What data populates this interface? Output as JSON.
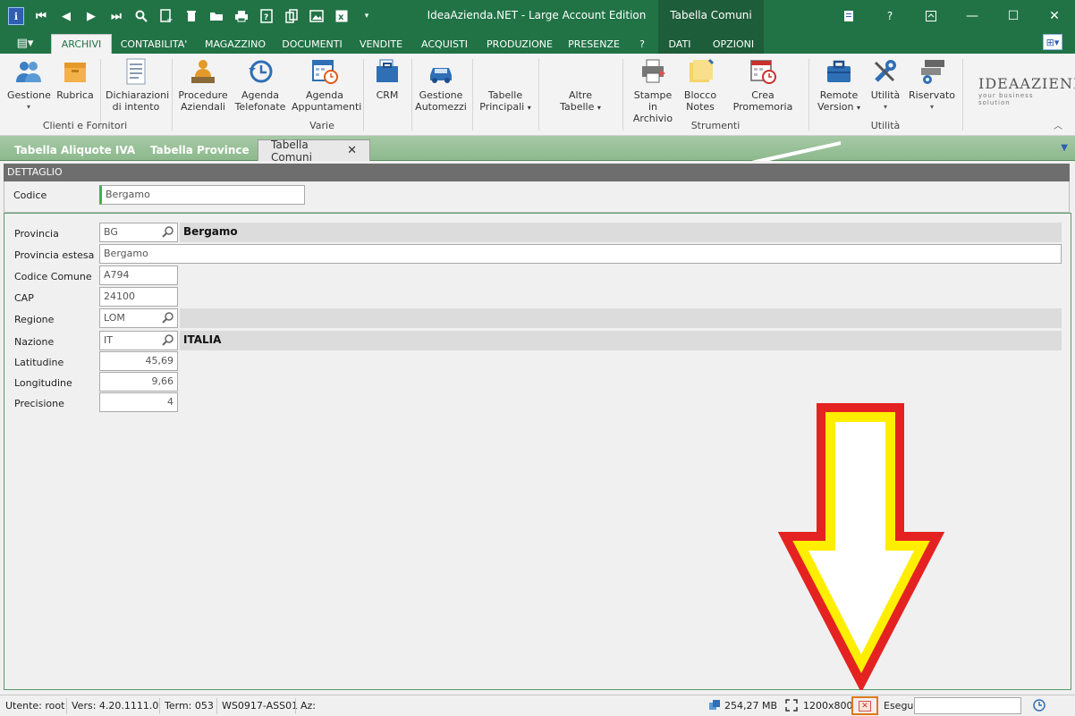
{
  "window": {
    "title": "IdeaAzienda.NET - Large Account Edition",
    "context_tab_title": "Tabella Comuni"
  },
  "ribbon_tabs": [
    {
      "label": "ARCHIVI",
      "active": true
    },
    {
      "label": "CONTABILITA'"
    },
    {
      "label": "MAGAZZINO"
    },
    {
      "label": "DOCUMENTI"
    },
    {
      "label": "VENDITE"
    },
    {
      "label": "ACQUISTI"
    },
    {
      "label": "PRODUZIONE"
    },
    {
      "label": "PRESENZE"
    },
    {
      "label": "?"
    },
    {
      "label": "DATI"
    },
    {
      "label": "OPZIONI"
    }
  ],
  "ribbon": {
    "buttons": {
      "gestione": "Gestione",
      "rubrica": "Rubrica",
      "dichiarazioni_1": "Dichiarazioni",
      "dichiarazioni_2": "di intento",
      "procedure_1": "Procedure",
      "procedure_2": "Aziendali",
      "agenda_tel_1": "Agenda",
      "agenda_tel_2": "Telefonate",
      "agenda_app_1": "Agenda",
      "agenda_app_2": "Appuntamenti",
      "crm": "CRM",
      "automezzi_1": "Gestione",
      "automezzi_2": "Automezzi",
      "tabelle_princ_1": "Tabelle",
      "tabelle_princ_2": "Principali",
      "altre_tab_1": "Altre",
      "altre_tab_2": "Tabelle",
      "stampe_1": "Stampe in",
      "stampe_2": "Archivio",
      "blocco_1": "Blocco",
      "blocco_2": "Notes",
      "promemoria": "Crea Promemoria",
      "remote_1": "Remote",
      "remote_2": "Version",
      "utilita": "Utilità",
      "riservato": "Riservato"
    },
    "groups": {
      "clienti_fornitori": "Clienti e Fornitori",
      "varie": "Varie",
      "strumenti": "Strumenti",
      "utilita": "Utilità"
    },
    "brand_line1": "IDEAAZIENDA",
    "brand_line2": "your business solution"
  },
  "doc_tabs": [
    {
      "label": "Tabella Aliquote IVA"
    },
    {
      "label": "Tabella Province"
    },
    {
      "label": "Tabella Comuni",
      "active": true
    }
  ],
  "detail": {
    "header": "DETTAGLIO",
    "codice_label": "Codice",
    "codice_value": "Bergamo"
  },
  "form": {
    "provincia": {
      "label": "Provincia",
      "value": "BG",
      "desc": "Bergamo"
    },
    "provincia_estesa": {
      "label": "Provincia estesa",
      "value": "Bergamo"
    },
    "codice_comune": {
      "label": "Codice Comune",
      "value": "A794"
    },
    "cap": {
      "label": "CAP",
      "value": "24100"
    },
    "regione": {
      "label": "Regione",
      "value": "LOM",
      "desc": ""
    },
    "nazione": {
      "label": "Nazione",
      "value": "IT",
      "desc": "ITALIA"
    },
    "latitudine": {
      "label": "Latitudine",
      "value": "45,69"
    },
    "longitudine": {
      "label": "Longitudine",
      "value": "9,66"
    },
    "precisione": {
      "label": "Precisione",
      "value": "4"
    }
  },
  "status": {
    "utente": "Utente: root",
    "versione": "Vers: 4.20.1111.0",
    "term": "Term: 053",
    "workstation": "WS0917-ASS01",
    "az": "Az:",
    "memory": "254,27 MB",
    "resolution": "1200x800",
    "esegui_label": "Esegui",
    "esegui_value": ""
  },
  "colors": {
    "title_green": "#217346",
    "highlight_arrow_outer": "#e52222",
    "highlight_arrow_inner": "#ffee00",
    "highlight_box": "#e0781a"
  }
}
